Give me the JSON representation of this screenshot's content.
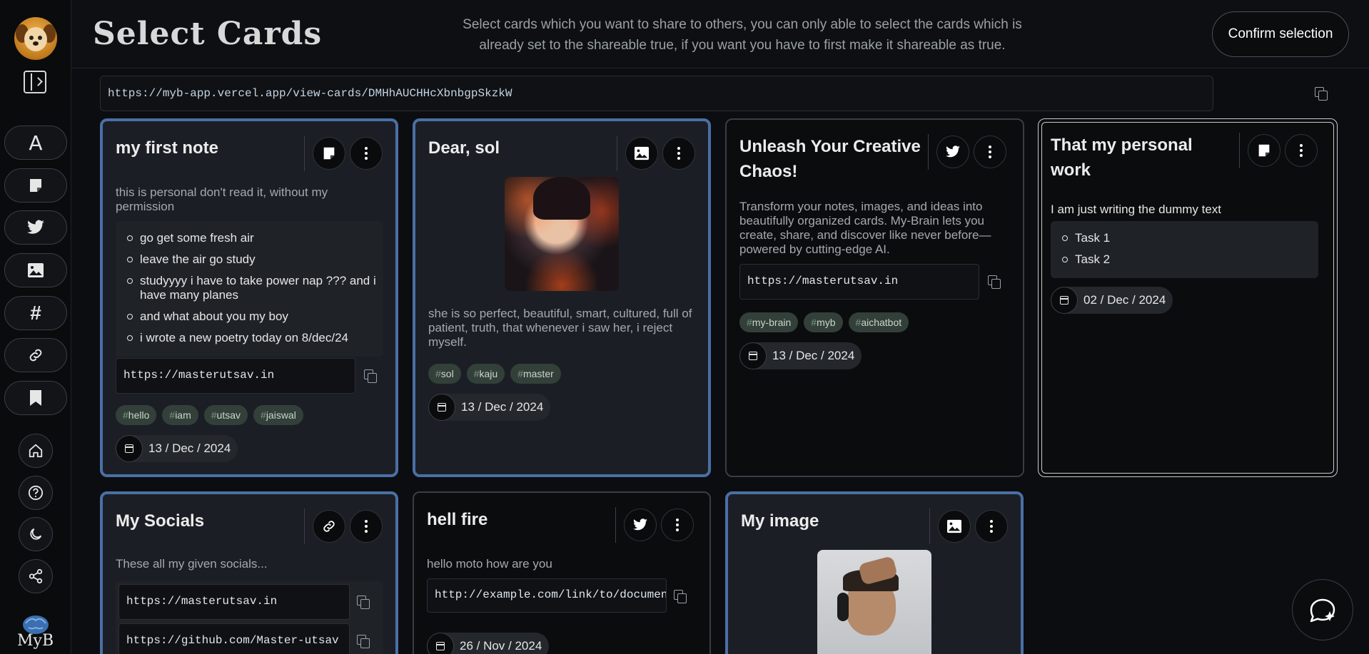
{
  "header": {
    "title": "Select Cards",
    "description": "Select cards which you want to share to others, you can only able to select the cards which is already set to the shareable true, if you want you have to first make it shareable as true.",
    "confirm_label": "Confirm selection"
  },
  "share": {
    "url": "https://myb-app.vercel.app/view-cards/DMHhAUCHHcXbnbgpSkzkW"
  },
  "sidebar": {
    "font_icon_label": "A",
    "tag_icon_label": "#",
    "items": [
      "font-icon",
      "note-icon",
      "twitter-icon",
      "image-icon",
      "hashtag-icon",
      "link-icon",
      "bookmark-icon"
    ],
    "circle_items": [
      "home-icon",
      "help-icon",
      "moon-icon",
      "share-icon"
    ]
  },
  "cards": [
    {
      "title": "my first note",
      "type_icon": "note-icon",
      "description": "this is personal don't read it, without my permission",
      "list": [
        "go get some fresh air",
        "leave the air go study",
        "studyyyy i have to take power nap ??? and i have many planes",
        "and what about you my boy",
        "i wrote a new poetry today on 8/dec/24"
      ],
      "link": "https://masterutsav.in",
      "tags": [
        "hello",
        "iam",
        "utsav",
        "jaiswal"
      ],
      "date": "13 / Dec / 2024"
    },
    {
      "title": "Dear, sol",
      "type_icon": "image-icon",
      "description": "she is so perfect, beautiful, smart, cultured, full of patient, truth, that whenever i saw her, i reject myself.",
      "tags": [
        "sol",
        "kaju",
        "master"
      ],
      "date": "13 / Dec / 2024"
    },
    {
      "title": "Unleash Your Creative Chaos!",
      "type_icon": "twitter-icon",
      "description": "Transform your notes, images, and ideas into beautifully organized cards. My-Brain lets you create, share, and discover like never before—powered by cutting-edge AI.",
      "link": "https://masterutsav.in",
      "tags": [
        "my-brain",
        "myb",
        "aichatbot"
      ],
      "date": "13 / Dec / 2024"
    },
    {
      "title": "That my personal work",
      "type_icon": "note-icon",
      "description": "I am just writing the dummy text",
      "list": [
        "Task 1",
        "Task 2"
      ],
      "date": "02 / Dec / 2024"
    },
    {
      "title": "My Socials",
      "type_icon": "link-icon",
      "description": "These all my given socials...",
      "links": [
        "https://masterutsav.in",
        "https://github.com/Master-utsav"
      ]
    },
    {
      "title": "hell fire",
      "type_icon": "twitter-icon",
      "description": "hello moto how are you",
      "link": "http://example.com/link/to/document",
      "date": "26 / Nov / 2024"
    },
    {
      "title": "My image",
      "type_icon": "image-icon"
    }
  ],
  "brand": {
    "logo_text": "MyB"
  }
}
